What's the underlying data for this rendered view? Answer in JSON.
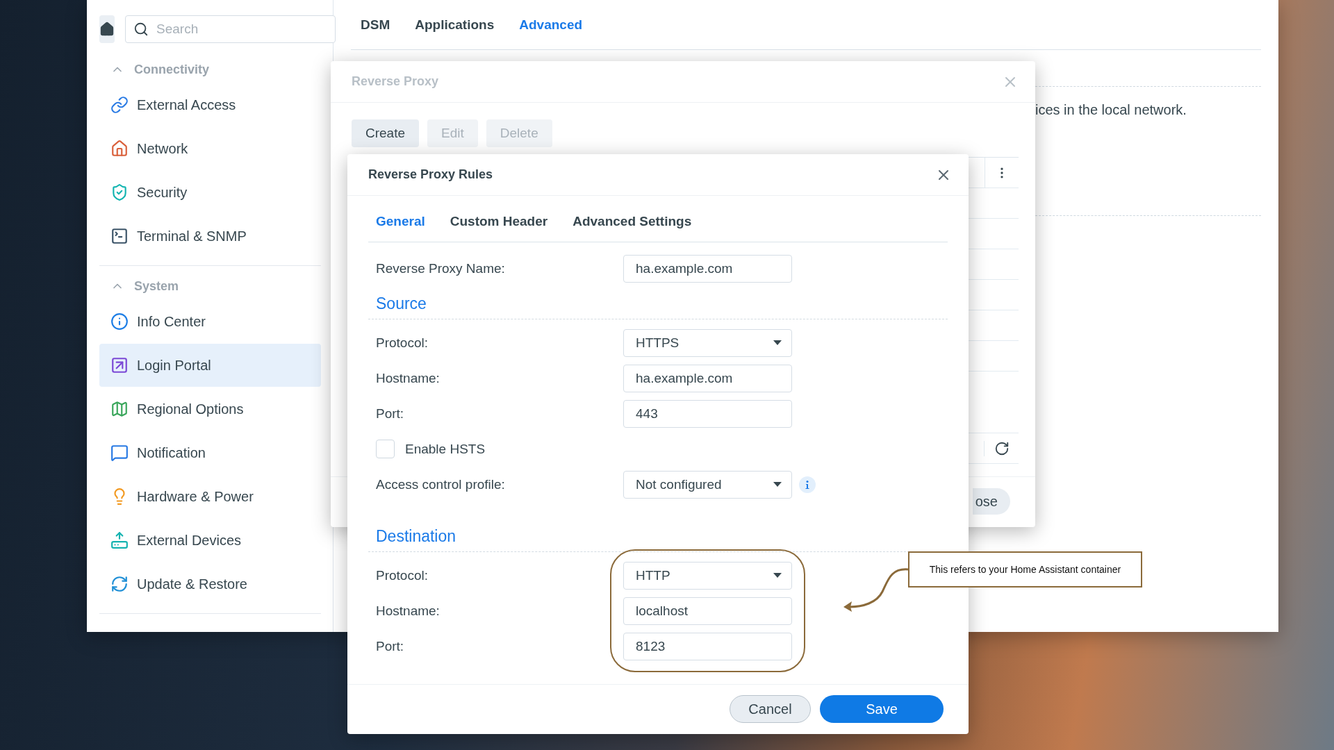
{
  "sidebar": {
    "search": {
      "placeholder": "Search"
    },
    "groups": [
      {
        "title": "Connectivity",
        "expanded": true,
        "items": [
          {
            "label": "External Access",
            "selected": false
          },
          {
            "label": "Network",
            "selected": false
          },
          {
            "label": "Security",
            "selected": false
          },
          {
            "label": "Terminal & SNMP",
            "selected": false
          }
        ]
      },
      {
        "title": "System",
        "expanded": true,
        "items": [
          {
            "label": "Info Center",
            "selected": false
          },
          {
            "label": "Login Portal",
            "selected": true
          },
          {
            "label": "Regional Options",
            "selected": false
          },
          {
            "label": "Notification",
            "selected": false
          },
          {
            "label": "Hardware & Power",
            "selected": false
          },
          {
            "label": "External Devices",
            "selected": false
          },
          {
            "label": "Update & Restore",
            "selected": false
          }
        ]
      }
    ]
  },
  "main_tabs": [
    {
      "label": "DSM",
      "selected": false
    },
    {
      "label": "Applications",
      "selected": false
    },
    {
      "label": "Advanced",
      "selected": true
    }
  ],
  "main_text": "ices in the local network.",
  "reverse_proxy_window": {
    "title": "Reverse Proxy",
    "buttons": [
      {
        "label": "Create",
        "disabled": false
      },
      {
        "label": "Edit",
        "disabled": true
      },
      {
        "label": "Delete",
        "disabled": true
      }
    ],
    "footer_button": "ose"
  },
  "rules_dialog": {
    "title": "Reverse Proxy Rules",
    "tabs": [
      {
        "label": "General",
        "selected": true
      },
      {
        "label": "Custom Header",
        "selected": false
      },
      {
        "label": "Advanced Settings",
        "selected": false
      }
    ],
    "name_row": {
      "label": "Reverse Proxy Name:",
      "value": "ha.example.com"
    },
    "sections": [
      {
        "title": "Source",
        "highlighted": false,
        "rows": [
          {
            "kind": "select",
            "label": "Protocol:",
            "value": "HTTPS"
          },
          {
            "kind": "input",
            "label": "Hostname:",
            "value": "ha.example.com"
          },
          {
            "kind": "input",
            "label": "Port:",
            "value": "443"
          },
          {
            "kind": "checkbox",
            "label": "Enable HSTS",
            "checked": false
          },
          {
            "kind": "select",
            "label": "Access control profile:",
            "value": "Not configured",
            "info": true
          }
        ]
      },
      {
        "title": "Destination",
        "highlighted": true,
        "rows": [
          {
            "kind": "select",
            "label": "Protocol:",
            "value": "HTTP"
          },
          {
            "kind": "input",
            "label": "Hostname:",
            "value": "localhost"
          },
          {
            "kind": "input",
            "label": "Port:",
            "value": "8123"
          }
        ]
      }
    ],
    "buttons": [
      {
        "label": "Cancel",
        "kind": "secondary"
      },
      {
        "label": "Save",
        "kind": "primary"
      }
    ]
  },
  "annotation": {
    "text": "This refers to your Home Assistant container"
  }
}
